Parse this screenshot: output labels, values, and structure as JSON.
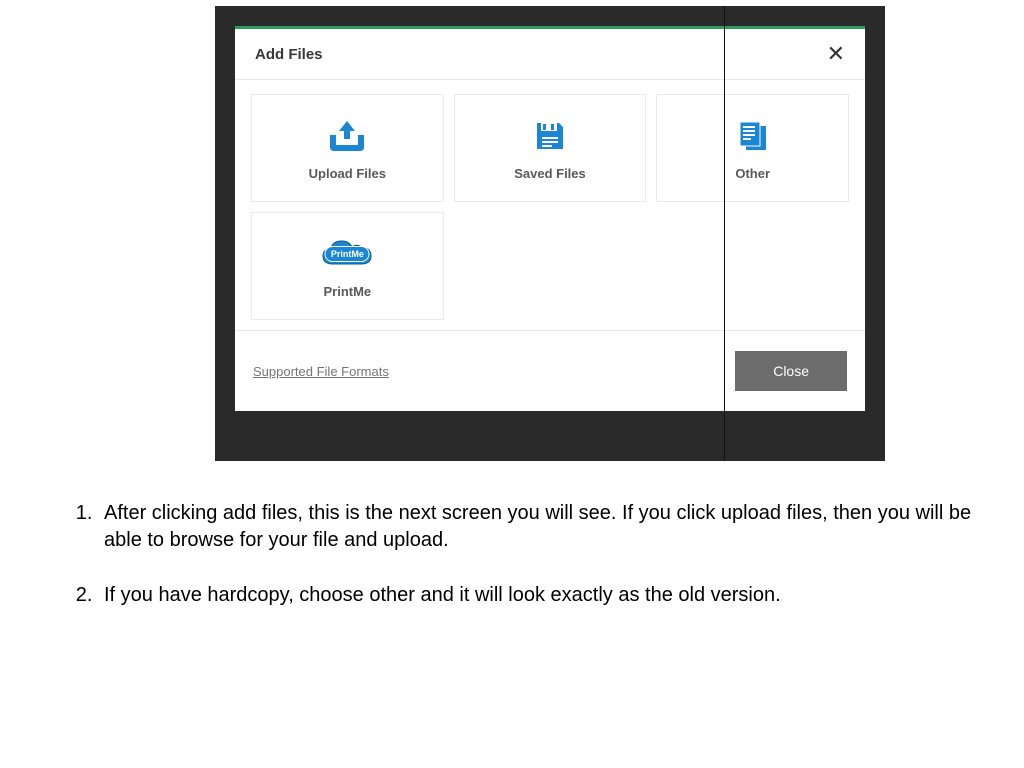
{
  "modal": {
    "title": "Add Files",
    "close_x": "✕",
    "options": {
      "upload": "Upload Files",
      "saved": "Saved Files",
      "other": "Other",
      "printme": "PrintMe",
      "printme_badge": "PrintMe"
    },
    "footer": {
      "supported_link": "Supported File Formats",
      "close_button": "Close"
    }
  },
  "instructions": {
    "item1": "After clicking add files, this is the next screen you will see. If you click upload files, then you will be able to browse for your file and upload.",
    "item2": "If you have hardcopy, choose other and it will look exactly as the old version."
  },
  "colors": {
    "accent_blue": "#1b87d4",
    "accent_green": "#2e9c5c"
  }
}
